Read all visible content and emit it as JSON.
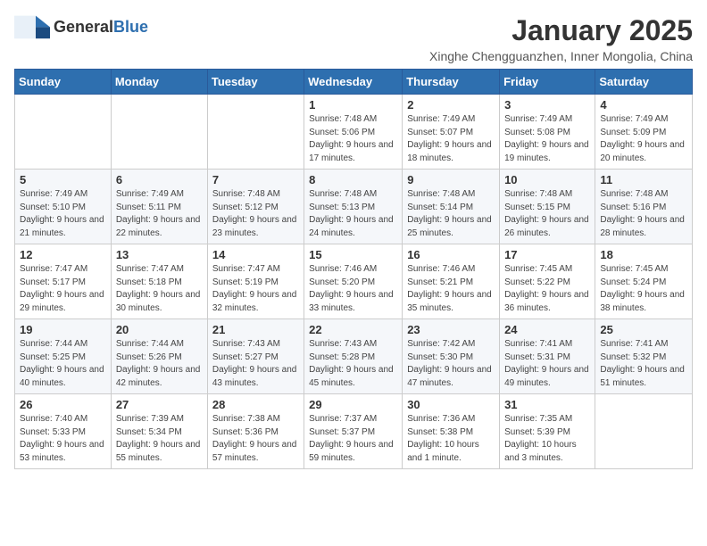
{
  "header": {
    "logo_general": "General",
    "logo_blue": "Blue",
    "month_title": "January 2025",
    "location": "Xinghe Chengguanzhen, Inner Mongolia, China"
  },
  "weekdays": [
    "Sunday",
    "Monday",
    "Tuesday",
    "Wednesday",
    "Thursday",
    "Friday",
    "Saturday"
  ],
  "weeks": [
    [
      {
        "day": "",
        "info": ""
      },
      {
        "day": "",
        "info": ""
      },
      {
        "day": "",
        "info": ""
      },
      {
        "day": "1",
        "info": "Sunrise: 7:48 AM\nSunset: 5:06 PM\nDaylight: 9 hours and 17 minutes."
      },
      {
        "day": "2",
        "info": "Sunrise: 7:49 AM\nSunset: 5:07 PM\nDaylight: 9 hours and 18 minutes."
      },
      {
        "day": "3",
        "info": "Sunrise: 7:49 AM\nSunset: 5:08 PM\nDaylight: 9 hours and 19 minutes."
      },
      {
        "day": "4",
        "info": "Sunrise: 7:49 AM\nSunset: 5:09 PM\nDaylight: 9 hours and 20 minutes."
      }
    ],
    [
      {
        "day": "5",
        "info": "Sunrise: 7:49 AM\nSunset: 5:10 PM\nDaylight: 9 hours and 21 minutes."
      },
      {
        "day": "6",
        "info": "Sunrise: 7:49 AM\nSunset: 5:11 PM\nDaylight: 9 hours and 22 minutes."
      },
      {
        "day": "7",
        "info": "Sunrise: 7:48 AM\nSunset: 5:12 PM\nDaylight: 9 hours and 23 minutes."
      },
      {
        "day": "8",
        "info": "Sunrise: 7:48 AM\nSunset: 5:13 PM\nDaylight: 9 hours and 24 minutes."
      },
      {
        "day": "9",
        "info": "Sunrise: 7:48 AM\nSunset: 5:14 PM\nDaylight: 9 hours and 25 minutes."
      },
      {
        "day": "10",
        "info": "Sunrise: 7:48 AM\nSunset: 5:15 PM\nDaylight: 9 hours and 26 minutes."
      },
      {
        "day": "11",
        "info": "Sunrise: 7:48 AM\nSunset: 5:16 PM\nDaylight: 9 hours and 28 minutes."
      }
    ],
    [
      {
        "day": "12",
        "info": "Sunrise: 7:47 AM\nSunset: 5:17 PM\nDaylight: 9 hours and 29 minutes."
      },
      {
        "day": "13",
        "info": "Sunrise: 7:47 AM\nSunset: 5:18 PM\nDaylight: 9 hours and 30 minutes."
      },
      {
        "day": "14",
        "info": "Sunrise: 7:47 AM\nSunset: 5:19 PM\nDaylight: 9 hours and 32 minutes."
      },
      {
        "day": "15",
        "info": "Sunrise: 7:46 AM\nSunset: 5:20 PM\nDaylight: 9 hours and 33 minutes."
      },
      {
        "day": "16",
        "info": "Sunrise: 7:46 AM\nSunset: 5:21 PM\nDaylight: 9 hours and 35 minutes."
      },
      {
        "day": "17",
        "info": "Sunrise: 7:45 AM\nSunset: 5:22 PM\nDaylight: 9 hours and 36 minutes."
      },
      {
        "day": "18",
        "info": "Sunrise: 7:45 AM\nSunset: 5:24 PM\nDaylight: 9 hours and 38 minutes."
      }
    ],
    [
      {
        "day": "19",
        "info": "Sunrise: 7:44 AM\nSunset: 5:25 PM\nDaylight: 9 hours and 40 minutes."
      },
      {
        "day": "20",
        "info": "Sunrise: 7:44 AM\nSunset: 5:26 PM\nDaylight: 9 hours and 42 minutes."
      },
      {
        "day": "21",
        "info": "Sunrise: 7:43 AM\nSunset: 5:27 PM\nDaylight: 9 hours and 43 minutes."
      },
      {
        "day": "22",
        "info": "Sunrise: 7:43 AM\nSunset: 5:28 PM\nDaylight: 9 hours and 45 minutes."
      },
      {
        "day": "23",
        "info": "Sunrise: 7:42 AM\nSunset: 5:30 PM\nDaylight: 9 hours and 47 minutes."
      },
      {
        "day": "24",
        "info": "Sunrise: 7:41 AM\nSunset: 5:31 PM\nDaylight: 9 hours and 49 minutes."
      },
      {
        "day": "25",
        "info": "Sunrise: 7:41 AM\nSunset: 5:32 PM\nDaylight: 9 hours and 51 minutes."
      }
    ],
    [
      {
        "day": "26",
        "info": "Sunrise: 7:40 AM\nSunset: 5:33 PM\nDaylight: 9 hours and 53 minutes."
      },
      {
        "day": "27",
        "info": "Sunrise: 7:39 AM\nSunset: 5:34 PM\nDaylight: 9 hours and 55 minutes."
      },
      {
        "day": "28",
        "info": "Sunrise: 7:38 AM\nSunset: 5:36 PM\nDaylight: 9 hours and 57 minutes."
      },
      {
        "day": "29",
        "info": "Sunrise: 7:37 AM\nSunset: 5:37 PM\nDaylight: 9 hours and 59 minutes."
      },
      {
        "day": "30",
        "info": "Sunrise: 7:36 AM\nSunset: 5:38 PM\nDaylight: 10 hours and 1 minute."
      },
      {
        "day": "31",
        "info": "Sunrise: 7:35 AM\nSunset: 5:39 PM\nDaylight: 10 hours and 3 minutes."
      },
      {
        "day": "",
        "info": ""
      }
    ]
  ]
}
